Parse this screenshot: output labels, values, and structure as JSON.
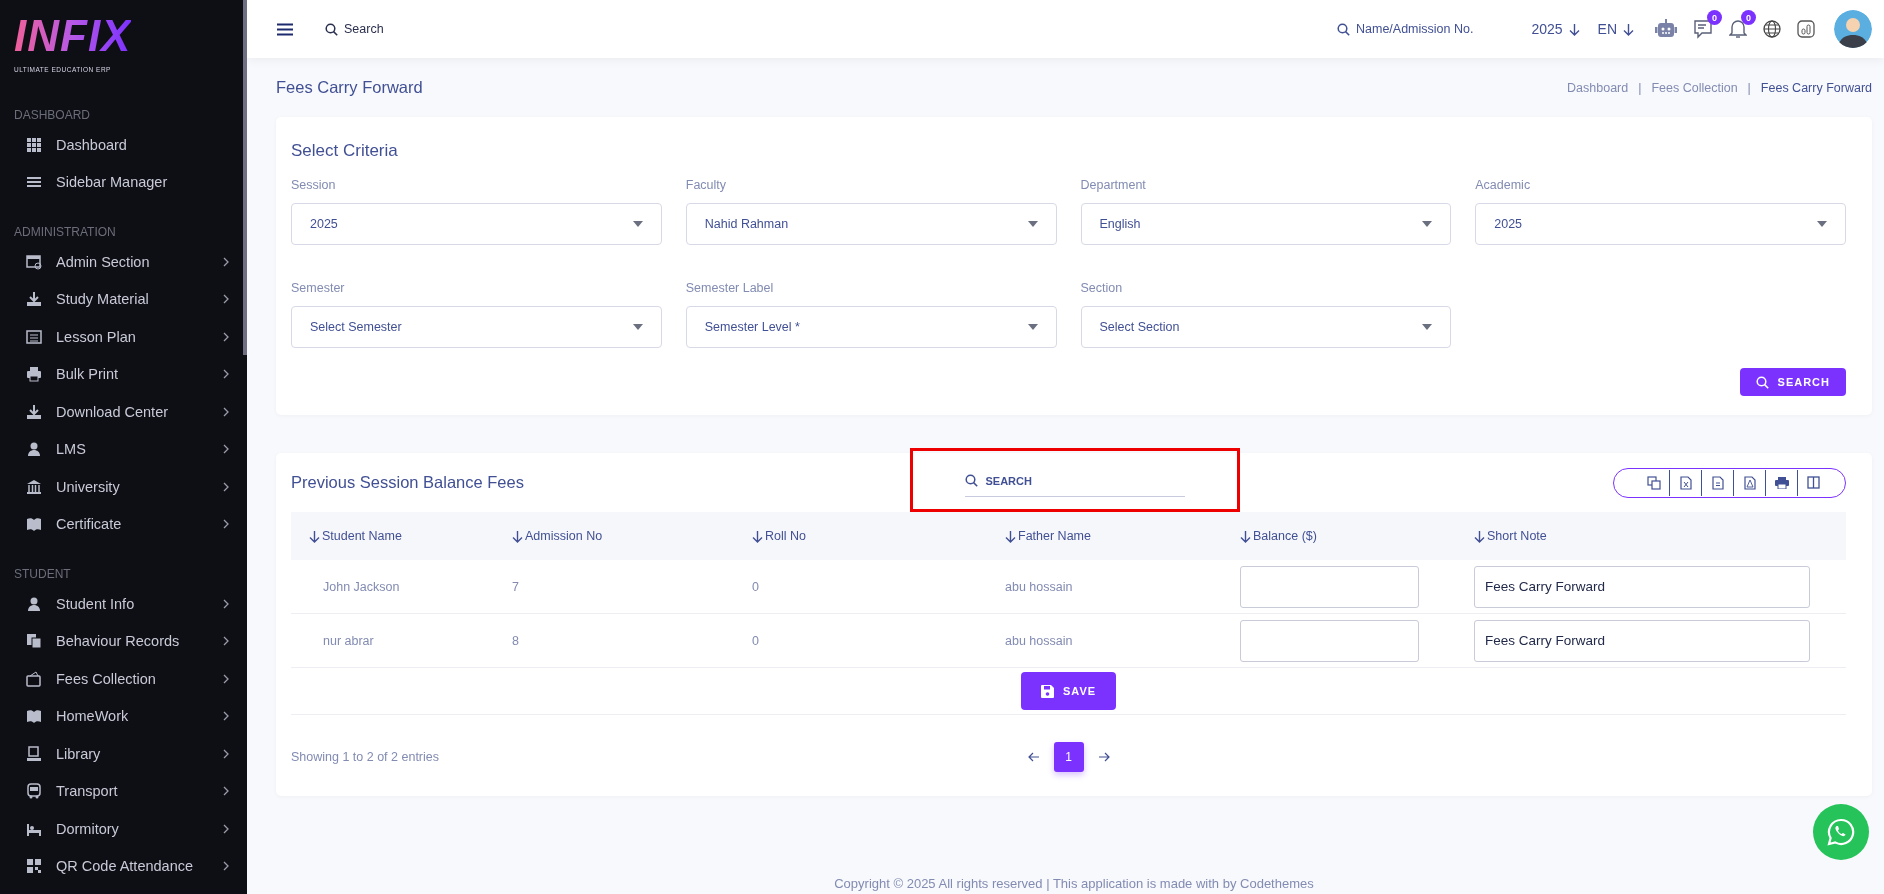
{
  "brand": {
    "logo": "INFIX",
    "tagline": "ULTIMATE EDUCATION ERP"
  },
  "sidebar": {
    "sections": [
      {
        "heading": "DASHBOARD",
        "items": [
          {
            "label": "Dashboard",
            "has_submenu": false
          },
          {
            "label": "Sidebar Manager",
            "has_submenu": false
          }
        ]
      },
      {
        "heading": "ADMINISTRATION",
        "items": [
          {
            "label": "Admin Section",
            "has_submenu": true
          },
          {
            "label": "Study Material",
            "has_submenu": true
          },
          {
            "label": "Lesson Plan",
            "has_submenu": true
          },
          {
            "label": "Bulk Print",
            "has_submenu": true
          },
          {
            "label": "Download Center",
            "has_submenu": true
          },
          {
            "label": "LMS",
            "has_submenu": true
          },
          {
            "label": "University",
            "has_submenu": true
          },
          {
            "label": "Certificate",
            "has_submenu": true
          }
        ]
      },
      {
        "heading": "STUDENT",
        "items": [
          {
            "label": "Student Info",
            "has_submenu": true
          },
          {
            "label": "Behaviour Records",
            "has_submenu": true
          },
          {
            "label": "Fees Collection",
            "has_submenu": true
          },
          {
            "label": "HomeWork",
            "has_submenu": true
          },
          {
            "label": "Library",
            "has_submenu": true
          },
          {
            "label": "Transport",
            "has_submenu": true
          },
          {
            "label": "Dormitory",
            "has_submenu": true
          },
          {
            "label": "QR Code Attendance",
            "has_submenu": true
          }
        ]
      }
    ]
  },
  "header": {
    "search_placeholder": "Search",
    "student_search_placeholder": "Name/Admission No.",
    "year": "2025",
    "language": "EN",
    "message_count": "0",
    "notification_count": "0"
  },
  "page": {
    "title": "Fees Carry Forward",
    "breadcrumb_separator": "|",
    "breadcrumbs": [
      {
        "label": "Dashboard",
        "selected": false
      },
      {
        "label": "Fees Collection",
        "selected": false
      },
      {
        "label": "Fees Carry Forward",
        "selected": true
      }
    ]
  },
  "criteria": {
    "title": "Select Criteria",
    "fields": [
      {
        "label": "Session",
        "value": "2025"
      },
      {
        "label": "Faculty",
        "value": "Nahid Rahman"
      },
      {
        "label": "Department",
        "value": "English"
      },
      {
        "label": "Academic",
        "value": "2025"
      },
      {
        "label": "Semester",
        "value": "Select Semester"
      },
      {
        "label": "Semester Label",
        "value": "Semester Level *"
      },
      {
        "label": "Section",
        "value": "Select Section"
      }
    ],
    "search_button": "SEARCH"
  },
  "balance": {
    "title": "Previous Session Balance Fees",
    "search_placeholder": "SEARCH",
    "columns": [
      "Student Name",
      "Admission No",
      "Roll No",
      "Father Name",
      "Balance ($)",
      "Short Note"
    ],
    "rows": [
      {
        "student_name": "John Jackson",
        "admission_no": "7",
        "roll_no": "0",
        "father_name": "abu hossain",
        "short_note": "Fees Carry Forward"
      },
      {
        "student_name": "nur abrar",
        "admission_no": "8",
        "roll_no": "0",
        "father_name": "abu hossain",
        "short_note": "Fees Carry Forward"
      }
    ],
    "save_button": "SAVE",
    "info": "Showing 1 to 2 of 2 entries",
    "pages": [
      {
        "label": "1",
        "selected": true
      }
    ]
  },
  "footer": "Copyright © 2025 All rights reserved | This application is made with by Codethemes"
}
